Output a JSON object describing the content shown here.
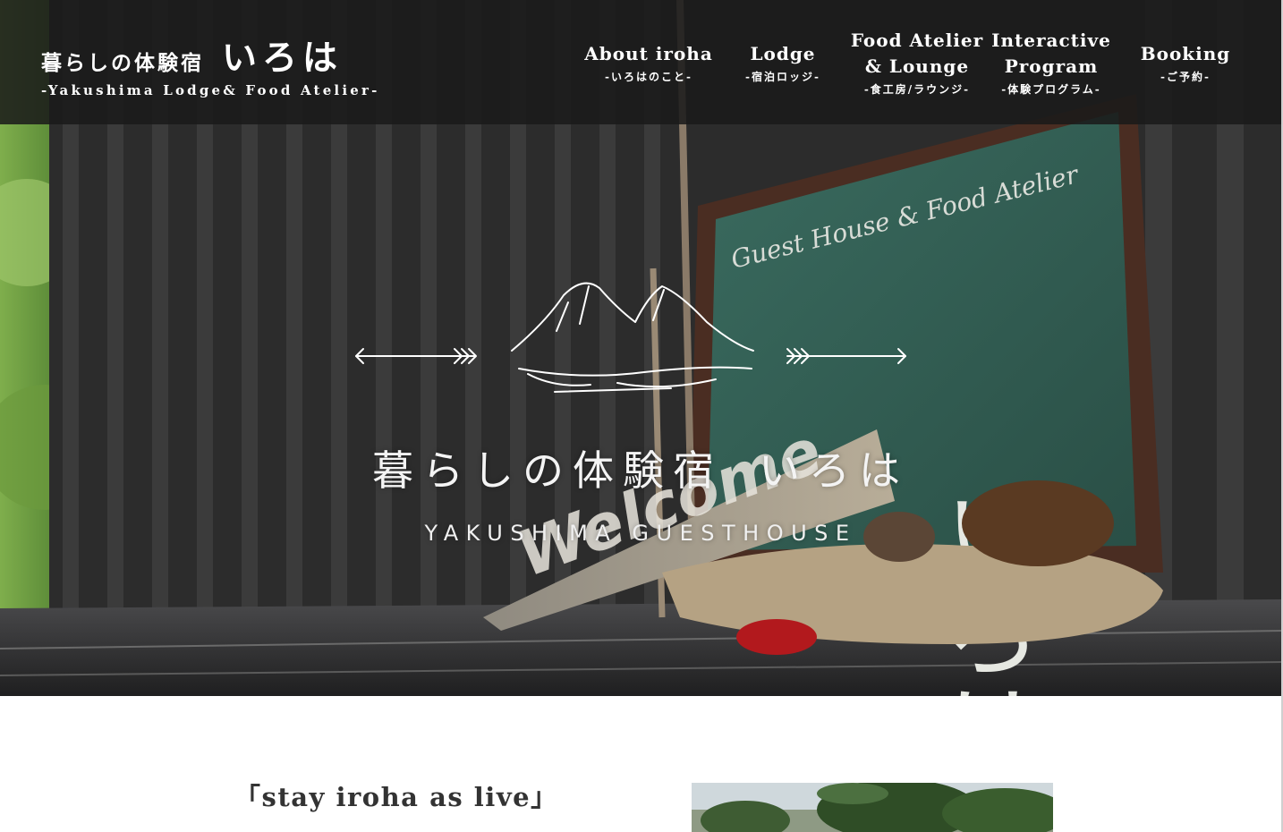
{
  "header": {
    "brand_jp_small": "暮らしの体験宿",
    "brand_jp_big": "いろは",
    "brand_en": "-Yakushima Lodge& Food Atelier-"
  },
  "nav": [
    {
      "en": "About iroha",
      "jp": "-いろはのこと-"
    },
    {
      "en": "Lodge",
      "jp": "-宿泊ロッジ-"
    },
    {
      "en": "Food Atelier\n& Lounge",
      "jp": "-食工房/ラウンジ-"
    },
    {
      "en": "Interactive\nProgram",
      "jp": "-体験プログラム-"
    },
    {
      "en": "Booking",
      "jp": "-ご予約-"
    }
  ],
  "hero": {
    "title_a": "暮らしの体験宿",
    "title_b": "いろは",
    "subtitle": "YAKUSHIMA GUESTHOUSE",
    "sign_line1": "Guest House & Food Atelier",
    "sign_kana": "いろは",
    "welcome_sign": "Welcome"
  },
  "intro": {
    "heading": "「stay iroha as live」"
  },
  "colors": {
    "header_bg": "#1a1a1a",
    "chalkboard": "#2f5a50",
    "wall": "#2b2b2b",
    "text_dark": "#333333"
  }
}
